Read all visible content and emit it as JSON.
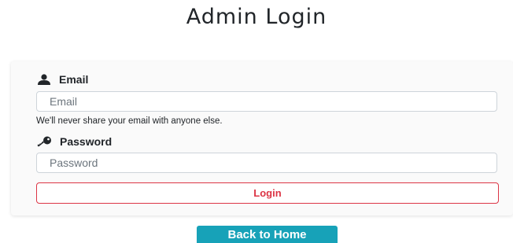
{
  "page": {
    "title": "Admin Login"
  },
  "form": {
    "email": {
      "label": "Email",
      "placeholder": "Email",
      "value": "",
      "help": "We'll never share your email with anyone else.",
      "icon": "user-icon"
    },
    "password": {
      "label": "Password",
      "placeholder": "Password",
      "value": "",
      "icon": "key-icon"
    },
    "login_label": "Login"
  },
  "footer": {
    "back_label": "Back to Home"
  },
  "colors": {
    "danger": "#dc3545",
    "info": "#17a2b8",
    "text": "#212529",
    "card_bg": "#fafafa"
  }
}
